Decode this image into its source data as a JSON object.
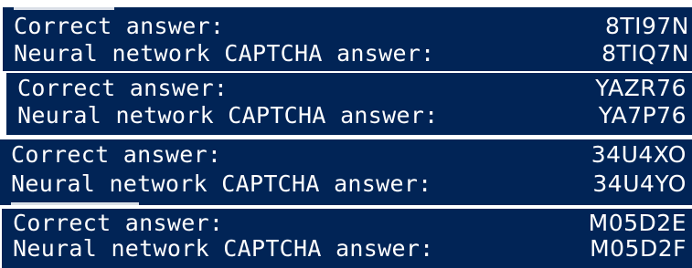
{
  "entries": [
    {
      "correct_label": "Correct answer:",
      "correct_value": "8TI97N",
      "neural_label": "Neural network CAPTCHA answer:",
      "neural_value": "8TIQ7N"
    },
    {
      "correct_label": "Correct answer:",
      "correct_value": "YAZR76",
      "neural_label": "Neural network CAPTCHA answer:",
      "neural_value": "YA7P76"
    },
    {
      "correct_label": "Correct answer:",
      "correct_value": "34U4XO",
      "neural_label": "Neural network CAPTCHA answer:",
      "neural_value": "34U4YO"
    },
    {
      "correct_label": "Correct answer:",
      "correct_value": "M05D2E",
      "neural_label": "Neural network CAPTCHA answer:",
      "neural_value": "M05D2F"
    }
  ],
  "colors": {
    "console_background": "#012456",
    "text": "#ffffff",
    "separator": "#ffffff"
  }
}
